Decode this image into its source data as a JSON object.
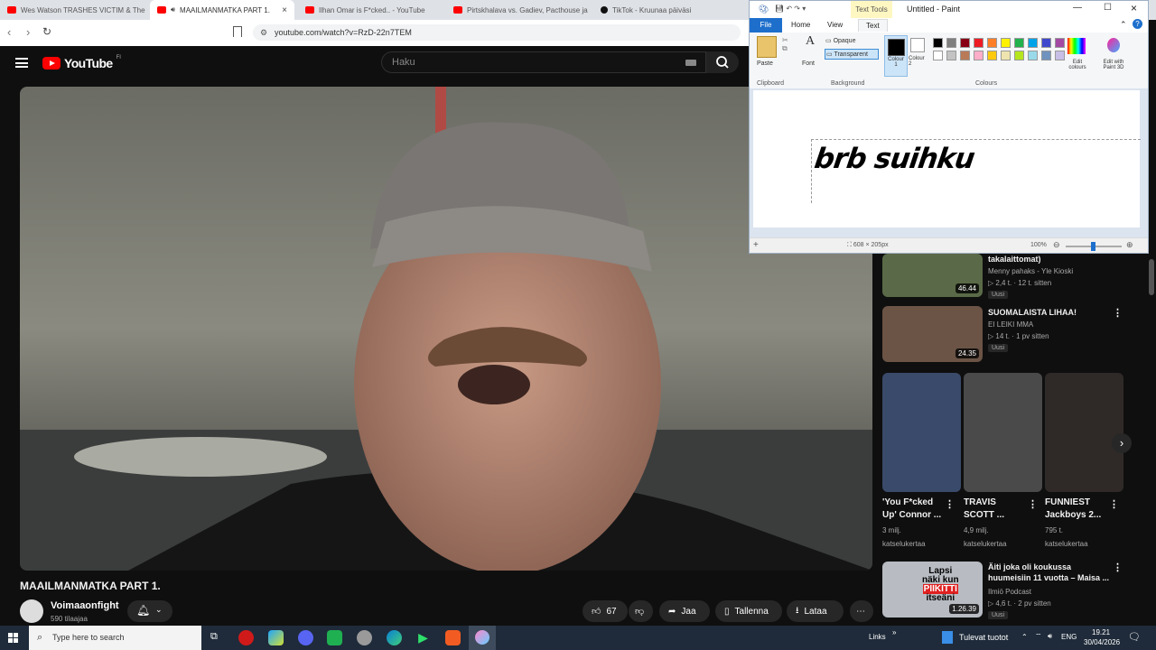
{
  "browser": {
    "tabs": [
      {
        "label": "Wes Watson TRASHES VICTIM & The",
        "favicon": "youtube-icon"
      },
      {
        "label": "MAAILMANMATKA PART 1.",
        "favicon": "youtube-icon",
        "active": true,
        "audio": true
      },
      {
        "label": "Ilhan Omar is F*cked.. - YouTube",
        "favicon": "youtube-icon"
      },
      {
        "label": "Pirtskhalava vs. Gadiev, Pacthouse ja",
        "favicon": "youtube-icon"
      },
      {
        "label": "TikTok - Kruunaa päiväsi",
        "favicon": "tiktok-icon"
      }
    ],
    "url": "youtube.com/watch?v=RzD-22n7TEM"
  },
  "youtube": {
    "logo_text": "YouTube",
    "country": "FI",
    "search_placeholder": "Haku"
  },
  "video": {
    "title": "MAAILMANMATKA PART 1.",
    "channel": "Voimaaonfight",
    "subscribers": "590 tilaajaa",
    "likes": "67",
    "share_label": "Jaa",
    "save_label": "Tallenna",
    "download_label": "Lataa"
  },
  "paint": {
    "window_title": "Untitled - Paint",
    "context_tab": "Text Tools",
    "tabs": [
      "File",
      "Home",
      "View",
      "Text"
    ],
    "ribbon": {
      "paste": "Paste",
      "font": "Font",
      "opaque": "Opaque",
      "transparent": "Transparent",
      "colour1": "Colour 1",
      "colour2": "Colour 2",
      "edit_colours": "Edit colours",
      "edit_paint3d": "Edit with Paint 3D",
      "groups": [
        "Clipboard",
        "Background",
        "Colours"
      ]
    },
    "canvas_text": "brb suihku",
    "status_size": "608 × 205px",
    "zoom": "100%",
    "palette": [
      "#000000",
      "#7f7f7f",
      "#880015",
      "#ed1c24",
      "#ff7f27",
      "#fff200",
      "#22b14c",
      "#00a2e8",
      "#3f48cc",
      "#a349a4",
      "#ffffff",
      "#c3c3c3",
      "#b97a57",
      "#ffaec9",
      "#ffc90e",
      "#efe4b0",
      "#b5e61d",
      "#99d9ea",
      "#7092be",
      "#c8bfe7"
    ]
  },
  "sidebar": {
    "items": [
      {
        "title": "takalaittomat)",
        "channel": "Menny pahaks - Yle Kioski",
        "views": "2,4 t.",
        "age": "12 t. sitten",
        "badge": "Uusi",
        "duration": "46.44"
      },
      {
        "title": "SUOMALAISTA LIHAA!",
        "channel": "EI LEIKI MMA",
        "views": "14 t.",
        "age": "1 pv sitten",
        "badge": "Uusi",
        "duration": "24.35"
      },
      {
        "title": "Äiti joka oli koukussa huumeisiin 11 vuotta – Maisa ...",
        "channel": "Ilmiö Podcast",
        "views": "4,6 t.",
        "age": "2 pv sitten",
        "badge": "Uusi",
        "duration": "1.26.39",
        "thumb_text": [
          "Lapsi",
          "näki kun",
          "PIIKITTI",
          "itseäni"
        ]
      }
    ],
    "shorts": [
      {
        "title": [
          "'You F*cked",
          "Up' Connor ..."
        ],
        "views": "3 milj.",
        "views2": "katselukertaa"
      },
      {
        "title": [
          "TRAVIS",
          "SCOTT ..."
        ],
        "views": "4,9 milj.",
        "views2": "katselukertaa"
      },
      {
        "title": [
          "FUNNIEST",
          "Jackboys 2..."
        ],
        "views": "795 t.",
        "views2": "katselukertaa"
      }
    ]
  },
  "taskbar": {
    "search_placeholder": "Type here to search",
    "links": "Links",
    "notification": "Tulevat tuotot",
    "lang": "ENG",
    "time": "19.21",
    "date": "30/04/2026"
  }
}
